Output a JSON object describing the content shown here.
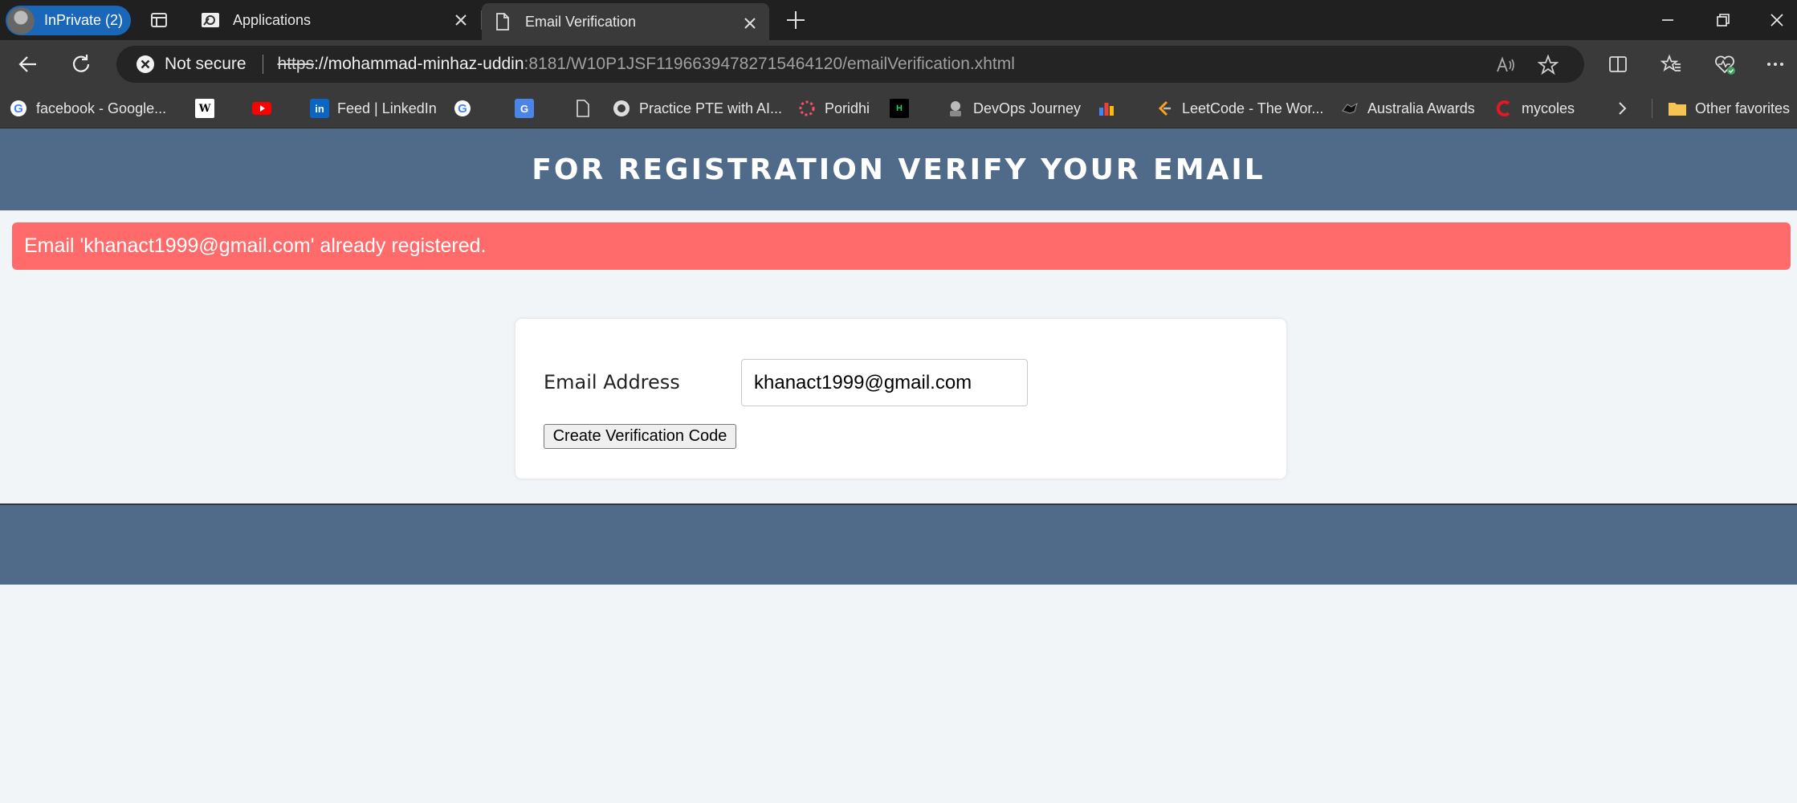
{
  "browser": {
    "profile_label": "InPrivate (2)",
    "tabs": [
      {
        "title": "Applications"
      },
      {
        "title": "Email Verification"
      }
    ],
    "address": {
      "security_label": "Not secure",
      "url_scheme": "https",
      "url_host": "://mohammad-minhaz-uddin",
      "url_rest": ":8181/W10P1JSF11966394782715464120/emailVerification.xhtml"
    },
    "favorites": [
      {
        "label": "facebook - Google...",
        "icon": "google-icon"
      },
      {
        "label": "",
        "icon": "wikipedia-icon"
      },
      {
        "label": "",
        "icon": "youtube-icon"
      },
      {
        "label": "Feed | LinkedIn",
        "icon": "linkedin-icon"
      },
      {
        "label": "",
        "icon": "google-icon"
      },
      {
        "label": "",
        "icon": "translate-icon"
      },
      {
        "label": "",
        "icon": "page-icon"
      },
      {
        "label": "Practice PTE with AI...",
        "icon": "pte-icon"
      },
      {
        "label": "Poridhi",
        "icon": "poridhi-icon"
      },
      {
        "label": "",
        "icon": "hackerrank-icon"
      },
      {
        "label": "DevOps Journey",
        "icon": "devops-icon"
      },
      {
        "label": "",
        "icon": "chart-icon"
      },
      {
        "label": "LeetCode - The Wor...",
        "icon": "leetcode-icon"
      },
      {
        "label": "Australia Awards",
        "icon": "australia-icon"
      },
      {
        "label": "mycoles",
        "icon": "coles-icon"
      }
    ],
    "other_favorites_label": "Other favorites"
  },
  "page": {
    "title": "FOR REGISTRATION VERIFY YOUR EMAIL",
    "alert_message": "Email 'khanact1999@gmail.com' already registered.",
    "form": {
      "email_label": "Email Address",
      "email_value": "khanact1999@gmail.com",
      "submit_label": "Create Verification Code"
    }
  },
  "colors": {
    "header_bg": "#506a89",
    "alert_bg": "#ff6b6b",
    "page_bg": "#f2f5f8",
    "profile_pill": "#1a66b8"
  }
}
